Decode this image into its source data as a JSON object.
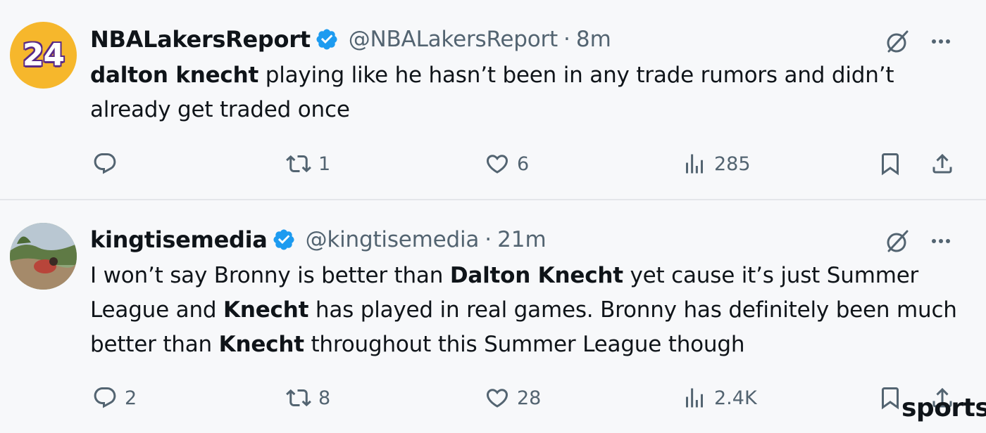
{
  "tweets": [
    {
      "name": "NBALakersReport",
      "handle": "@NBALakersReport",
      "separator": "·",
      "time": "8m",
      "avatar_text": "24",
      "body": [
        {
          "text": "dalton knecht",
          "bold": true
        },
        {
          "text": " playing like he hasn’t been in any trade rumors and didn’t already get traded once",
          "bold": false
        }
      ],
      "actions": {
        "reply": "",
        "retweet": "1",
        "like": "6",
        "views": "285"
      }
    },
    {
      "name": "kingtisemedia",
      "handle": "@kingtisemedia",
      "separator": "·",
      "time": "21m",
      "body": [
        {
          "text": "I won’t say Bronny is better than ",
          "bold": false
        },
        {
          "text": "Dalton Knecht",
          "bold": true
        },
        {
          "text": " yet cause it’s just Summer League and ",
          "bold": false
        },
        {
          "text": "Knecht",
          "bold": true
        },
        {
          "text": " has played in real games. Bronny has definitely been much better than ",
          "bold": false
        },
        {
          "text": "Knecht",
          "bold": true
        },
        {
          "text": " throughout this Summer League though",
          "bold": false
        }
      ],
      "actions": {
        "reply": "2",
        "retweet": "8",
        "like": "28",
        "views": "2.4K"
      }
    }
  ],
  "watermark": "sports",
  "colors": {
    "verified": "#1d9bf0",
    "muted": "#536471",
    "text": "#0f1419",
    "avatar_bg": "#f6b72c"
  },
  "icons": [
    "verified-badge-icon",
    "grok-icon",
    "more-icon",
    "reply-icon",
    "retweet-icon",
    "like-icon",
    "views-icon",
    "bookmark-icon",
    "share-icon"
  ]
}
